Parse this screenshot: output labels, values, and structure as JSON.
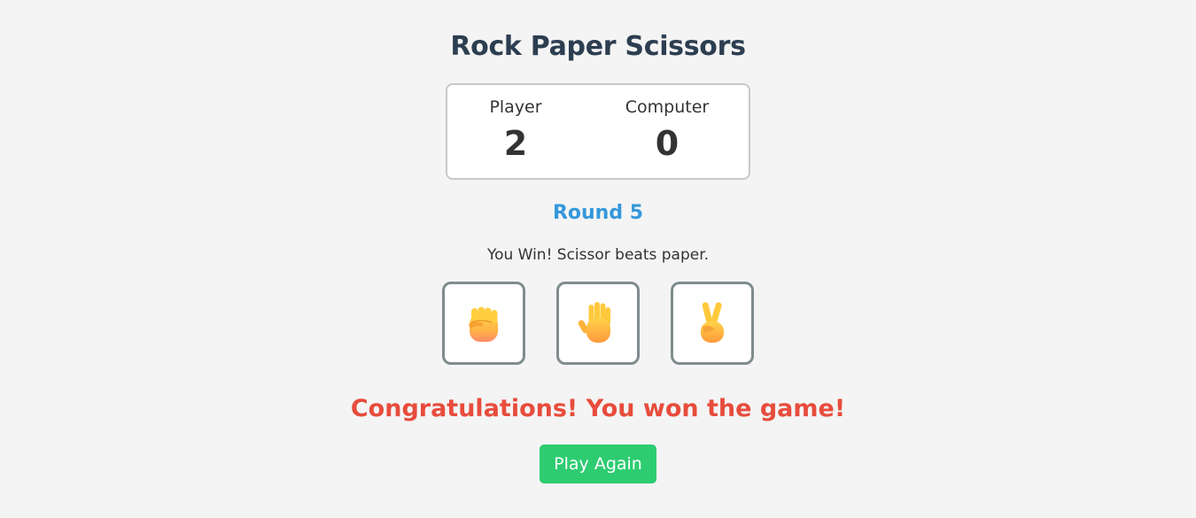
{
  "title": "Rock Paper Scissors",
  "scoreboard": {
    "player_label": "Player",
    "player_score": "2",
    "computer_label": "Computer",
    "computer_score": "0"
  },
  "round": "Round 5",
  "result": "You Win! Scissor beats paper.",
  "choices": [
    {
      "name": "rock",
      "icon": "raised-fist-icon"
    },
    {
      "name": "paper",
      "icon": "raised-hand-icon"
    },
    {
      "name": "scissors",
      "icon": "victory-hand-icon"
    }
  ],
  "final_message": "Congratulations! You won the game!",
  "play_again_label": "Play Again",
  "colors": {
    "background": "#f4f4f4",
    "title": "#2c3e50",
    "round": "#3498db",
    "final_message": "#e74c3c",
    "play_again": "#2ecc71",
    "choice_border": "#7f8c8d",
    "emoji_skin": "#f7b731"
  }
}
